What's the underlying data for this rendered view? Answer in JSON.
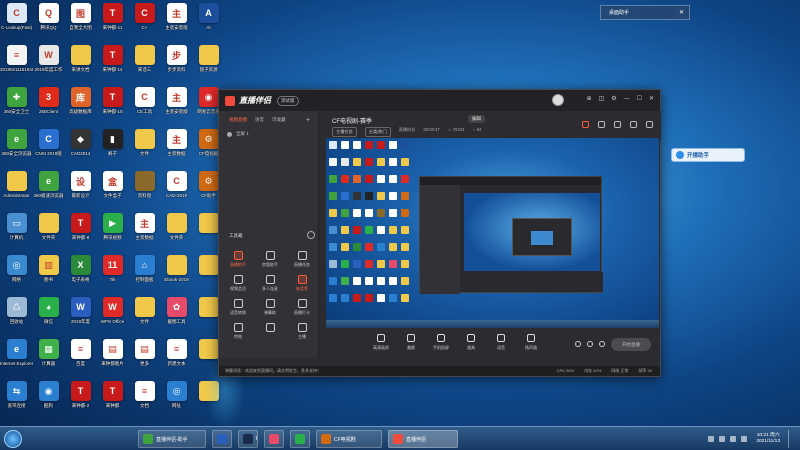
{
  "desktop": {
    "icons": [
      {
        "label": "C-Lookup(Fast)",
        "color": "#dce9f7",
        "glyph": "C"
      },
      {
        "label": "腾讯QQ",
        "color": "#ffffff",
        "glyph": "Q"
      },
      {
        "label": "自我全大图",
        "color": "#ffffff",
        "glyph": "图"
      },
      {
        "label": "来钟都-11",
        "color": "#c81a1a",
        "glyph": "T"
      },
      {
        "label": "C+",
        "color": "#c81a1a",
        "glyph": "C"
      },
      {
        "label": "主装安装版",
        "color": "#ffffff",
        "glyph": "主"
      },
      {
        "label": "AI",
        "color": "#1b4f9c",
        "glyph": "A"
      },
      {
        "label": "2019021115184543425",
        "color": "#f5f5f5",
        "glyph": "≡"
      },
      {
        "label": "2019年度工作",
        "color": "#e8e8e8",
        "glyph": "W"
      },
      {
        "label": "来讲文档",
        "color": "#f0c84a",
        "glyph": ""
      },
      {
        "label": "来钟都-14",
        "color": "#c81a1a",
        "glyph": "T"
      },
      {
        "label": "来话三",
        "color": "#f0c84a",
        "glyph": ""
      },
      {
        "label": "步步资料",
        "color": "#ffffff",
        "glyph": "步"
      },
      {
        "label": "镜子资源",
        "color": "#f0c84a",
        "glyph": ""
      },
      {
        "label": "360安全卫士",
        "color": "#3fa33f",
        "glyph": "✚"
      },
      {
        "label": "250Client",
        "color": "#e02a1a",
        "glyph": "3"
      },
      {
        "label": "高级数据库",
        "color": "#e0632a",
        "glyph": "库"
      },
      {
        "label": "来钟都-10",
        "color": "#c81a1a",
        "glyph": "T"
      },
      {
        "label": "CE工具",
        "color": "#ffffff",
        "glyph": "C"
      },
      {
        "label": "主装安装版",
        "color": "#ffffff",
        "glyph": "主"
      },
      {
        "label": "网易云音乐",
        "color": "#e02a2a",
        "glyph": "◉"
      },
      {
        "label": "360安全浏览器",
        "color": "#3fa33f",
        "glyph": "e"
      },
      {
        "label": "CNSI 2019版",
        "color": "#2a6fd0",
        "glyph": "C"
      },
      {
        "label": "CAD2014",
        "color": "#333333",
        "glyph": "◆"
      },
      {
        "label": "裤子",
        "color": "#222222",
        "glyph": "▮"
      },
      {
        "label": "文件",
        "color": "#f0c84a",
        "glyph": ""
      },
      {
        "label": "主装数据",
        "color": "#ffffff",
        "glyph": "主"
      },
      {
        "label": "CF电视剧",
        "color": "#d26a14",
        "glyph": "⚙"
      },
      {
        "label": "Administrator",
        "color": "#f0c84a",
        "glyph": ""
      },
      {
        "label": "360极速浏览器",
        "color": "#3fa33f",
        "glyph": "e"
      },
      {
        "label": "最新设计",
        "color": "#ffffff",
        "glyph": "设"
      },
      {
        "label": "文件盒子",
        "color": "#ffffff",
        "glyph": "盒"
      },
      {
        "label": "资料盘",
        "color": "#8a6a2a",
        "glyph": ""
      },
      {
        "label": "CAD-2019",
        "color": "#ffffff",
        "glyph": "C"
      },
      {
        "label": "CF助手",
        "color": "#d26a14",
        "glyph": "⚙"
      },
      {
        "label": "计算机",
        "color": "#4a90d0",
        "glyph": "▭"
      },
      {
        "label": "文件夹",
        "color": "#f0c84a",
        "glyph": ""
      },
      {
        "label": "来钟都-8",
        "color": "#c81a1a",
        "glyph": "T"
      },
      {
        "label": "腾讯视频",
        "color": "#2ab04a",
        "glyph": "▶"
      },
      {
        "label": "主装数据",
        "color": "#ffffff",
        "glyph": "主"
      },
      {
        "label": "文件夹",
        "color": "#f0c84a",
        "glyph": ""
      },
      {
        "label": "",
        "color": "#f0c84a",
        "glyph": ""
      },
      {
        "label": "网络",
        "color": "#3a8ad0",
        "glyph": "◎"
      },
      {
        "label": "图书",
        "color": "#f0c84a",
        "glyph": "▥"
      },
      {
        "label": "电子表格",
        "color": "#2a8a3a",
        "glyph": "X"
      },
      {
        "label": "Tik",
        "color": "#e02a2a",
        "glyph": "11"
      },
      {
        "label": "控制面板",
        "color": "#2a7fd0",
        "glyph": "⌂"
      },
      {
        "label": "Ebook-2019",
        "color": "#f0c84a",
        "glyph": ""
      },
      {
        "label": "",
        "color": "#f0c84a",
        "glyph": ""
      },
      {
        "label": "回收站",
        "color": "#9cb9d6",
        "glyph": "♺"
      },
      {
        "label": "微信",
        "color": "#2ab04a",
        "glyph": "◕"
      },
      {
        "label": "2019年度",
        "color": "#2a5fbf",
        "glyph": "W"
      },
      {
        "label": "WPS Office",
        "color": "#e02a2a",
        "glyph": "W"
      },
      {
        "label": "文件",
        "color": "#f0c84a",
        "glyph": ""
      },
      {
        "label": "截图工具",
        "color": "#e84a6a",
        "glyph": "✿"
      },
      {
        "label": "",
        "color": "#f0c84a",
        "glyph": ""
      },
      {
        "label": "Internet Explorer",
        "color": "#2a7fd0",
        "glyph": "e"
      },
      {
        "label": "计算器",
        "color": "#3fb04a",
        "glyph": "▦"
      },
      {
        "label": "百度",
        "color": "#ffffff",
        "glyph": "≡"
      },
      {
        "label": "来钟都图片",
        "color": "#ffffff",
        "glyph": "▤"
      },
      {
        "label": "更多",
        "color": "#ffffff",
        "glyph": "▤"
      },
      {
        "label": "新建文本",
        "color": "#ffffff",
        "glyph": "≡"
      },
      {
        "label": "",
        "color": "#f0c84a",
        "glyph": ""
      },
      {
        "label": "宽带连接",
        "color": "#2a7fd0",
        "glyph": "⇆"
      },
      {
        "label": "酷狗",
        "color": "#2a7fd0",
        "glyph": "◉"
      },
      {
        "label": "来钟都-2",
        "color": "#c81a1a",
        "glyph": "T"
      },
      {
        "label": "来钟都",
        "color": "#c81a1a",
        "glyph": "T"
      },
      {
        "label": "文档",
        "color": "#ffffff",
        "glyph": "≡"
      },
      {
        "label": "网址",
        "color": "#2a7fd0",
        "glyph": "◎"
      },
      {
        "label": "",
        "color": "#f0c84a",
        "glyph": ""
      }
    ]
  },
  "gadget": {
    "label": "桌面助手",
    "close": "✕"
  },
  "app": {
    "title": "直播伴侣",
    "version_badge": "测试版",
    "window_buttons": [
      "⊕",
      "◫",
      "⚙",
      "—",
      "☐",
      "✕"
    ],
    "left_tabs": [
      "视频直播",
      "语音",
      "可收藏"
    ],
    "scene_label": "全屏 1",
    "tools_title": "工具箱",
    "tools": [
      {
        "label": "直播助手",
        "red": true
      },
      {
        "label": "房管助手",
        "red": false
      },
      {
        "label": "直播任务",
        "red": false
      },
      {
        "label": "视频会员",
        "red": false
      },
      {
        "label": "多人连麦",
        "red": false
      },
      {
        "label": "抽奖等",
        "red": true
      },
      {
        "label": "语音转换",
        "red": false
      },
      {
        "label": "弹幕助",
        "red": false
      },
      {
        "label": "直播打卡",
        "red": false
      },
      {
        "label": "特效",
        "red": false
      },
      {
        "label": "",
        "red": false
      },
      {
        "label": "主播",
        "red": false
      }
    ],
    "stream_title": "CF电视剧-赛季",
    "edit_label": "编辑",
    "info_row": [
      "主播任务",
      "分类/热门",
      "直播时长",
      "00:00:47",
      "♨ 78223",
      "♁ 84"
    ],
    "bottom_tools": [
      "高清画质",
      "美颜",
      "手机投屏",
      "道具",
      "语音",
      "扬声器"
    ],
    "go_live_label": "开始直播",
    "status_text": "弹幕消息：欢迎来到直播间，请文明发言，多多支持！",
    "status_right": [
      "CPU 36%",
      "内存 62%",
      "网络 正常",
      "帧率 30"
    ]
  },
  "overlay_badge": {
    "label": "开播助手"
  },
  "taskbar": {
    "items": [
      {
        "label": "直播伴侣-助手",
        "color": "#3fa33f",
        "active": false
      },
      {
        "label": "",
        "color": "#2a5fbf",
        "active": false
      },
      {
        "label": "Ps",
        "color": "#1a2a4a",
        "active": false
      },
      {
        "label": "",
        "color": "#e84a6a",
        "active": false
      },
      {
        "label": "",
        "color": "#2ab04a",
        "active": false
      },
      {
        "label": "CF电视剧",
        "color": "#d26a14",
        "active": false
      },
      {
        "label": "直播伴侣",
        "color": "#f04b3c",
        "active": true
      }
    ],
    "clock_time": "10:21 周六",
    "clock_date": "2021/11/13"
  }
}
